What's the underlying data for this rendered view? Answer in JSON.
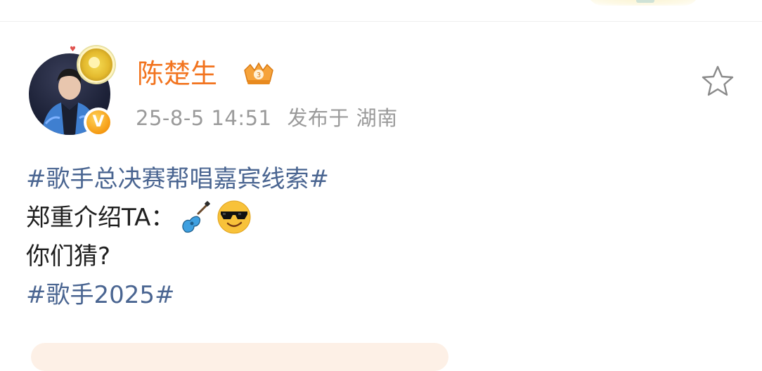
{
  "post": {
    "author": {
      "name": "陈楚生",
      "verified_mark": "V",
      "avatar_icon": "avatar-icon",
      "rank_badge_icon": "crown-badge-icon"
    },
    "timestamp": "25-8-5 14:51",
    "location_text": "发布于 湖南",
    "favorite_icon": "star-outline-icon",
    "content": {
      "hashtag_1": "#歌手总决赛帮唱嘉宾线索#",
      "line_2_text": "郑重介绍TA：",
      "line_2_emojis": [
        "guitar-icon",
        "cool-face-icon"
      ],
      "line_3_text": "你们猜?",
      "hashtag_2": "#歌手2025#"
    }
  },
  "colors": {
    "username": "#f2741f",
    "hashtag": "#4a6591",
    "meta": "#9a9a9a",
    "body_text": "#1f1f1f"
  }
}
